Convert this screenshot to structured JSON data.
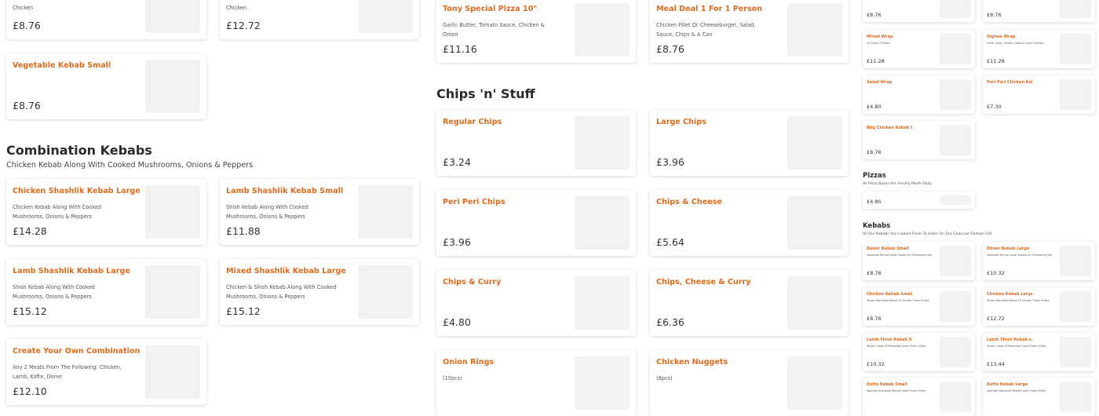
{
  "col1": {
    "top_cards": [
      {
        "title": "",
        "desc": "Chicken",
        "price": "£8.76"
      },
      {
        "title": "",
        "desc": "Chicken",
        "price": "£12.72"
      }
    ],
    "vegetable_card": {
      "title": "Vegetable Kebab Small",
      "price": "£8.76"
    },
    "combo_section": {
      "title": "Combination Kebabs",
      "subtitle": "Chicken Kebab Along With Cooked Mushrooms, Onions & Peppers"
    },
    "combo_items": [
      {
        "title": "Chicken Shashlik Kebab Large",
        "desc": "Chicken Kebab Along With Cooked Mushrooms, Onions & Peppers",
        "price": "£14.28"
      },
      {
        "title": "Lamb Shashlik Kebab Small",
        "desc": "Shish Kebab Along With Cooked Mushrooms, Onions & Peppers",
        "price": "£11.88"
      },
      {
        "title": "Lamb Shashlik Kebab Large",
        "desc": "Shish Kebab Along With Cooked Mushrooms, Onions & Peppers",
        "price": "£15.12"
      },
      {
        "title": "Mixed Shashlik Kebab Large",
        "desc": "Chicken & Shish Kebab Along With Cooked Mushrooms, Onions & Peppers",
        "price": "£15.12"
      },
      {
        "title": "Create Your Own Combination",
        "desc": "Any 2 Meats From The Following: Chicken, Lamb, Kofte, Doner",
        "price": "£12.10"
      }
    ]
  },
  "col2": {
    "top_cards": [
      {
        "title": "Tony Special Pizza 10\"",
        "desc": "Garlic Butter, Tomato Sauce, Chicken & Onion",
        "price": "£11.16"
      },
      {
        "title": "Meal Deal 1 For 1 Person",
        "desc": "Chicken Fillet Or Cheeseburger, Salad, Sauce, Chips & A Can",
        "price": "£8.76"
      }
    ],
    "chips_section": {
      "title": "Chips 'n' Stuff"
    },
    "chips_items": [
      {
        "title": "Regular Chips",
        "desc": "",
        "price": "£3.24"
      },
      {
        "title": "Large Chips",
        "desc": "",
        "price": "£3.96"
      },
      {
        "title": "Peri Peri Chips",
        "desc": "",
        "price": "£3.96"
      },
      {
        "title": "Chips & Cheese",
        "desc": "",
        "price": "£5.64"
      },
      {
        "title": "Chips & Curry",
        "desc": "",
        "price": "£4.80"
      },
      {
        "title": "Chips, Cheese & Curry",
        "desc": "",
        "price": "£6.36"
      },
      {
        "title": "Onion Rings",
        "desc": "(10pcs)",
        "price": ""
      },
      {
        "title": "Chicken Nuggets",
        "desc": "(8pcs)",
        "price": ""
      }
    ]
  },
  "col3": {
    "wraps": [
      {
        "title": "",
        "desc": "",
        "price": "£8.76"
      },
      {
        "title": "",
        "desc": "",
        "price": "£8.76"
      },
      {
        "title": "Mixed Wrap",
        "desc": "(2 Choice Of Meat)",
        "price": "£11.28"
      },
      {
        "title": "Highee Wrap",
        "desc": "Lamb, Chips, Cheese, Salad & Sauce (combo)",
        "price": "£11.28"
      },
      {
        "title": "Salad Wrap",
        "desc": "",
        "price": "£4.80"
      },
      {
        "title": "Peri Peri Chicken Kebab Wrap",
        "desc": "",
        "price": "£7.30"
      },
      {
        "title": "Bbq Chicken Kebab Wrap",
        "desc": "",
        "price": "£8.76"
      }
    ],
    "pizzas_section": {
      "title": "Pizzas",
      "subtitle": "All Pizza Bases Are Freshly Made Daily"
    },
    "pizza_card": {
      "title": "",
      "price": "£4.80"
    },
    "kebabs_section": {
      "title": "Kebabs",
      "subtitle": "All Our Kebabs Are Cooked Fresh To Order On Our Charcoal Flamed Grill"
    },
    "kebabs": [
      {
        "title": "Doner Kebab Small",
        "desc": "Seasoned Minced Lamb Cooked On A Revolving Spit",
        "price": "£8.76"
      },
      {
        "title": "Doner Kebab Large",
        "desc": "Seasoned Minced Lamb Cooked On A Revolving Spit",
        "price": "£10.32"
      },
      {
        "title": "Chicken Kebab Small",
        "desc": "Tender Marinated Breast Of Chicken Flame Grilled",
        "price": "£8.76"
      },
      {
        "title": "Chicken Kebab Large",
        "desc": "Tender Marinated Breast Of Chicken Flame Grilled",
        "price": "£12.72"
      },
      {
        "title": "Lamb Shish Kebab Small",
        "desc": "Tender Cubes Of Marinated Lamb Flame Grilled",
        "price": "£10.32"
      },
      {
        "title": "Lamb Shish Kebab Large",
        "desc": "Tender Cubes Of Marinated Lamb Flame Grilled",
        "price": "£13.44"
      },
      {
        "title": "Kofte Kebab Small",
        "desc": "Specially Seasoned Minced Lamb Flame Grilled",
        "price": ""
      },
      {
        "title": "Kofte Kebab Large",
        "desc": "Specially Seasoned Minced Lamb Flame Grilled",
        "price": ""
      }
    ]
  }
}
